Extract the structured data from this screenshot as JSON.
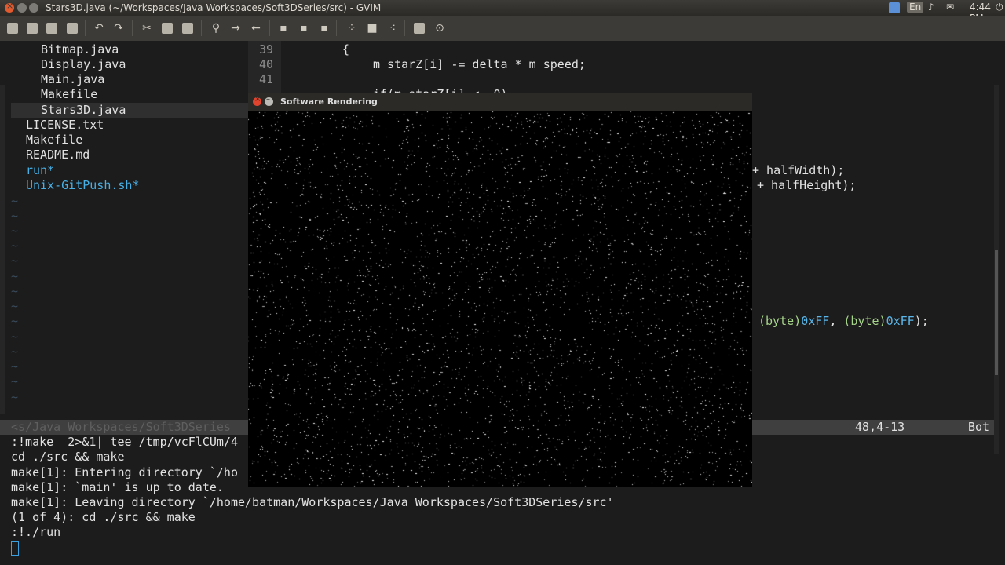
{
  "window": {
    "title": "Stars3D.java (~/Workspaces/Java Workspaces/Soft3DSeries/src) - GVIM"
  },
  "tray": {
    "keyboard": "En",
    "time": "4:44 PM"
  },
  "colors": {
    "accent_blue": "#47b0e6",
    "close_red": "#e25a2e"
  },
  "tree": {
    "items": [
      {
        "label": "Bitmap.java",
        "indent": 2,
        "type": "file"
      },
      {
        "label": "Display.java",
        "indent": 2,
        "type": "file"
      },
      {
        "label": "Main.java",
        "indent": 2,
        "type": "file"
      },
      {
        "label": "Makefile",
        "indent": 2,
        "type": "file"
      },
      {
        "label": "Stars3D.java",
        "indent": 2,
        "type": "file",
        "selected": true
      },
      {
        "label": "LICENSE.txt",
        "indent": 1,
        "type": "file"
      },
      {
        "label": "Makefile",
        "indent": 1,
        "type": "file"
      },
      {
        "label": "README.md",
        "indent": 1,
        "type": "file"
      },
      {
        "label": "run*",
        "indent": 1,
        "type": "exec"
      },
      {
        "label": "Unix-GitPush.sh*",
        "indent": 1,
        "type": "exec"
      }
    ],
    "tilde": "~"
  },
  "code": {
    "line_numbers": [
      "39",
      "40",
      "41"
    ],
    "lines": [
      "{",
      "m_starZ[i] -= delta * m_speed;",
      ""
    ],
    "partial_line": "if(m_starZ[i] <= 0)",
    "right_fragments": [
      "+ halfWidth);",
      "+ halfHeight);"
    ],
    "color_args": {
      "kw1": "(byte)",
      "hex1": "0xFF",
      "sep": ", ",
      "kw2": "(byte)",
      "hex2": "0xFF",
      "end": ");"
    }
  },
  "status": {
    "path": "<s/Java Workspaces/Soft3DSeries",
    "position": "48,4-13",
    "scroll": "Bot"
  },
  "cmdline": [
    ":!make  2>&1| tee /tmp/vcFlCUm/4",
    "cd ./src && make",
    "make[1]: Entering directory `/ho",
    "make[1]: `main' is up to date.",
    "make[1]: Leaving directory `/home/batman/Workspaces/Java Workspaces/Soft3DSeries/src'",
    "(1 of 4): cd ./src && make",
    ":!./run"
  ],
  "popup": {
    "title": "Software Rendering"
  }
}
